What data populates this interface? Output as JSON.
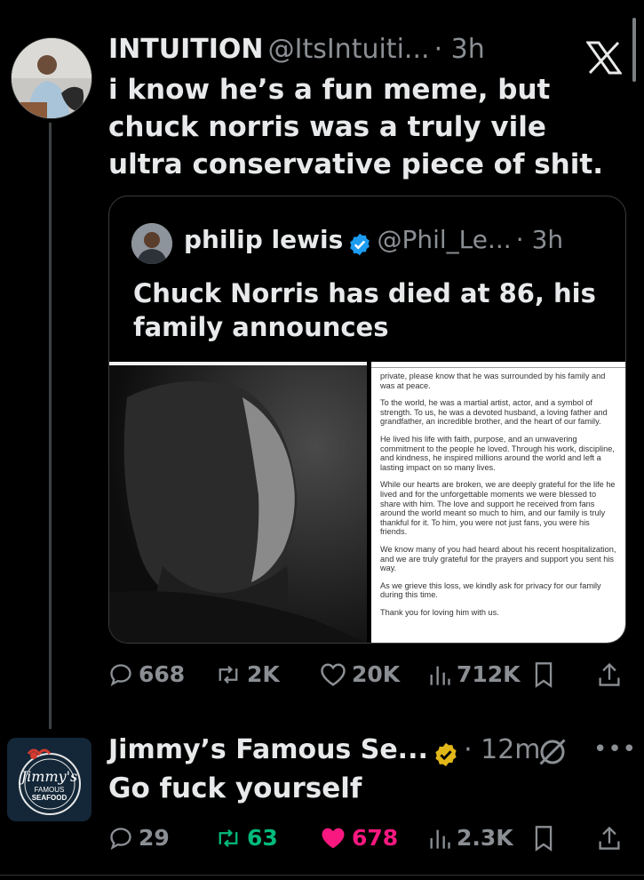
{
  "tweet1": {
    "name": "INTUITION",
    "handle": "@ItsIntuiti...",
    "time": "· 3h",
    "text": "i know he’s a fun meme, but chuck norris was a truly vile ultra conservative piece of shit.",
    "actions": {
      "replies": "668",
      "reposts": "2K",
      "likes": "20K",
      "views": "712K"
    }
  },
  "quote": {
    "name": "philip lewis",
    "handle": "@Phil_Le...",
    "time": "· 3h",
    "text": "Chuck Norris has died at 86, his family announces",
    "statement_paragraphs": [
      "private, please know that he was surrounded by his family and was at peace.",
      "To the world, he was a martial artist, actor, and a symbol of strength. To us, he was a devoted husband, a loving father and grandfather, an incredible brother, and the heart of our family.",
      "He lived his life with faith, purpose, and an unwavering commitment to the people he loved. Through his work, discipline, and kindness, he inspired millions around the world and left a lasting impact on so many lives.",
      "While our hearts are broken, we are deeply grateful for the life he lived and for the unforgettable moments we were blessed to share with him. The love and support he received from fans around the world meant so much to him, and our family is truly thankful for it. To him, you were not just fans, you were his friends.",
      "We know many of you had heard about his recent hospitalization, and we are truly grateful for the prayers and support you sent his way.",
      "As we grieve this loss, we kindly ask for privacy for our family during this time.",
      "Thank you for loving him with us."
    ]
  },
  "tweet2": {
    "name": "Jimmy’s Famous Se...",
    "time": "· 12m",
    "text": "Go fuck yourself",
    "avatar_logo": {
      "line1": "Jimmy's",
      "line2": "FAMOUS",
      "line3": "SEAFOOD"
    },
    "actions": {
      "replies": "29",
      "reposts": "63",
      "likes": "678",
      "views": "2.3K"
    }
  },
  "colors": {
    "background": "#000000",
    "text": "#e7e9ea",
    "muted": "#8b8f94",
    "verified_blue": "#1d9bf0",
    "verified_gold": "#e2b719",
    "repost_green": "#00ba7c",
    "like_pink": "#f91880"
  }
}
